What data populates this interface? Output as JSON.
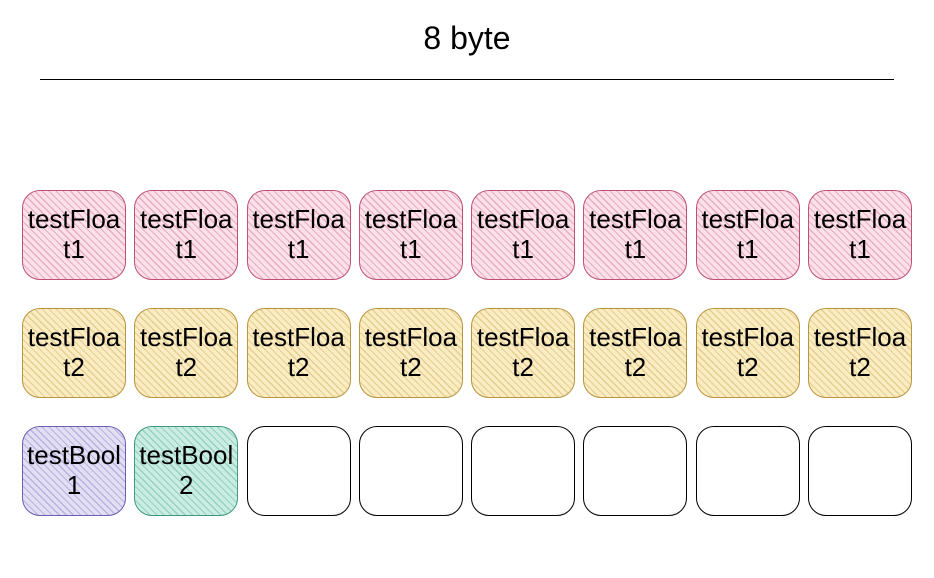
{
  "title": "8 byte",
  "rows": [
    {
      "cells": [
        {
          "label": "testFloat1",
          "style": "hatch-pink"
        },
        {
          "label": "testFloat1",
          "style": "hatch-pink"
        },
        {
          "label": "testFloat1",
          "style": "hatch-pink"
        },
        {
          "label": "testFloat1",
          "style": "hatch-pink"
        },
        {
          "label": "testFloat1",
          "style": "hatch-pink"
        },
        {
          "label": "testFloat1",
          "style": "hatch-pink"
        },
        {
          "label": "testFloat1",
          "style": "hatch-pink"
        },
        {
          "label": "testFloat1",
          "style": "hatch-pink"
        }
      ]
    },
    {
      "cells": [
        {
          "label": "testFloat2",
          "style": "hatch-yellow"
        },
        {
          "label": "testFloat2",
          "style": "hatch-yellow"
        },
        {
          "label": "testFloat2",
          "style": "hatch-yellow"
        },
        {
          "label": "testFloat2",
          "style": "hatch-yellow"
        },
        {
          "label": "testFloat2",
          "style": "hatch-yellow"
        },
        {
          "label": "testFloat2",
          "style": "hatch-yellow"
        },
        {
          "label": "testFloat2",
          "style": "hatch-yellow"
        },
        {
          "label": "testFloat2",
          "style": "hatch-yellow"
        }
      ]
    },
    {
      "cells": [
        {
          "label": "testBool1",
          "style": "hatch-purple"
        },
        {
          "label": "testBool2",
          "style": "hatch-teal"
        },
        {
          "label": "",
          "style": "empty"
        },
        {
          "label": "",
          "style": "empty"
        },
        {
          "label": "",
          "style": "empty"
        },
        {
          "label": "",
          "style": "empty"
        },
        {
          "label": "",
          "style": "empty"
        },
        {
          "label": "",
          "style": "empty"
        }
      ]
    }
  ]
}
